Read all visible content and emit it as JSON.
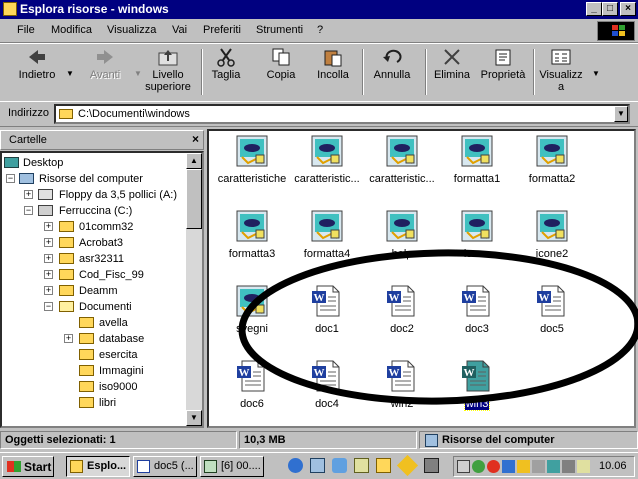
{
  "window": {
    "title": "Esplora risorse - windows",
    "min_label": "_",
    "max_label": "□",
    "close_label": "×"
  },
  "menu": [
    "File",
    "Modifica",
    "Visualizza",
    "Vai",
    "Preferiti",
    "Strumenti",
    "?"
  ],
  "toolbar": {
    "back": "Indietro",
    "forward": "Avanti",
    "up_line1": "Livello",
    "up_line2": "superiore",
    "cut": "Taglia",
    "copy": "Copia",
    "paste": "Incolla",
    "undo": "Annulla",
    "delete": "Elimina",
    "properties": "Proprietà",
    "views_line1": "Visualizz",
    "views_line2": "a"
  },
  "address": {
    "label": "Indirizzo",
    "value": "C:\\Documenti\\windows"
  },
  "folders_pane": {
    "title": "Cartelle",
    "close": "×"
  },
  "tree": [
    "Desktop",
    "Risorse del computer",
    "Floppy da 3,5 pollici (A:)",
    "Ferruccina (C:)",
    "01comm32",
    "Acrobat3",
    "asr32311",
    "Cod_Fisc_99",
    "Deamm",
    "Documenti",
    "avella",
    "database",
    "esercita",
    "Immagini",
    "iso9000",
    "libri"
  ],
  "files": [
    {
      "name": "caratteristiche",
      "type": "image"
    },
    {
      "name": "caratteristic...",
      "type": "image"
    },
    {
      "name": "caratteristic...",
      "type": "image"
    },
    {
      "name": "formatta1",
      "type": "image"
    },
    {
      "name": "formatta2",
      "type": "image"
    },
    {
      "name": "formatta3",
      "type": "image"
    },
    {
      "name": "formatta4",
      "type": "image"
    },
    {
      "name": "help",
      "type": "image"
    },
    {
      "name": "icone",
      "type": "image"
    },
    {
      "name": "icone2",
      "type": "image"
    },
    {
      "name": "svegni",
      "type": "image"
    },
    {
      "name": "doc1",
      "type": "word"
    },
    {
      "name": "doc2",
      "type": "word"
    },
    {
      "name": "doc3",
      "type": "word"
    },
    {
      "name": "doc5",
      "type": "word"
    },
    {
      "name": "doc6",
      "type": "word"
    },
    {
      "name": "doc4",
      "type": "word"
    },
    {
      "name": "win2",
      "type": "word"
    },
    {
      "name": "win3",
      "type": "word",
      "selected": true
    }
  ],
  "status": {
    "selected": "Oggetti selezionati: 1",
    "size": "10,3 MB",
    "location": "Risorse del computer"
  },
  "taskbar": {
    "start": "Start",
    "tasks": [
      "Esplo...",
      "doc5 (...",
      "[6] 00...."
    ],
    "clock": "10.06"
  },
  "colors": {
    "title_bg": "#000080",
    "face": "#c0c0c0",
    "word_blue": "#1f3f9f",
    "selected_teal": "#40a0a0"
  }
}
